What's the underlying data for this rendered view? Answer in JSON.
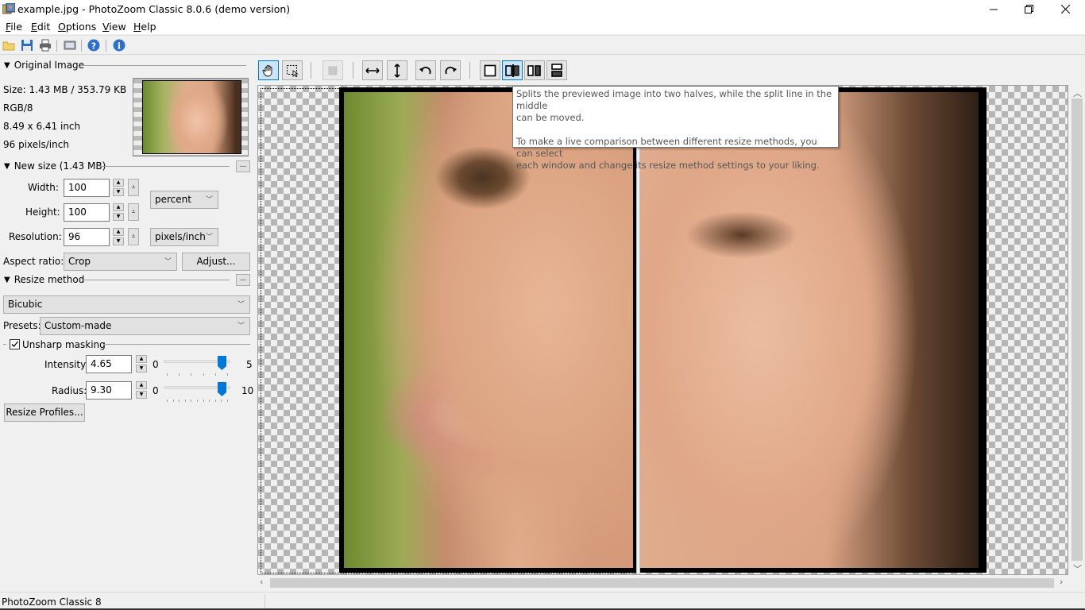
{
  "window": {
    "title": "example.jpg - PhotoZoom Classic 8.0.6 (demo version)",
    "controls": [
      "minimize",
      "restore",
      "close"
    ]
  },
  "menubar": {
    "items": [
      {
        "label": "File",
        "accel": "F"
      },
      {
        "label": "Edit",
        "accel": "E"
      },
      {
        "label": "Options",
        "accel": "O"
      },
      {
        "label": "View",
        "accel": "V"
      },
      {
        "label": "Help",
        "accel": "H"
      }
    ]
  },
  "toolbar": {
    "icons": [
      "open-folder-icon",
      "save-icon",
      "print-icon",
      "screen-icon",
      "help-icon",
      "info-icon"
    ]
  },
  "original_image": {
    "header": "Original Image",
    "size": "Size: 1.43 MB / 353.79 KB",
    "mode": "RGB/8",
    "dimensions": "8.49 x 6.41 inch",
    "resolution": "96 pixels/inch"
  },
  "new_size": {
    "header": "New size (1.43 MB)",
    "more_label": "...",
    "width_label": "Width:",
    "width_value": "100",
    "height_label": "Height:",
    "height_value": "100",
    "unit": "percent",
    "resolution_label": "Resolution:",
    "resolution_value": "96",
    "resolution_unit": "pixels/inch",
    "aspect_label": "Aspect ratio:",
    "aspect_value": "Crop",
    "adjust_label": "Adjust..."
  },
  "resize_method": {
    "header": "Resize method",
    "more_label": "...",
    "method": "Bicubic",
    "presets_label": "Presets:",
    "presets_value": "Custom-made",
    "unsharp_label": "Unsharp masking",
    "unsharp_checked": true,
    "intensity_label": "Intensity:",
    "intensity_value": "4.65",
    "intensity_min": "0",
    "intensity_max": "5",
    "intensity_fraction": 0.93,
    "radius_label": "Radius:",
    "radius_value": "9.30",
    "radius_min": "0",
    "radius_max": "10",
    "radius_fraction": 0.93,
    "profiles_label": "Resize Profiles..."
  },
  "view_toolbar": {
    "buttons": [
      {
        "name": "hand-tool",
        "active": true
      },
      {
        "name": "selection-tool",
        "active": false
      },
      {
        "name": "crop-tool",
        "active": false,
        "disabled": true
      },
      {
        "name": "fit-width",
        "active": false
      },
      {
        "name": "fit-height",
        "active": false
      },
      {
        "name": "rotate-left",
        "active": false
      },
      {
        "name": "rotate-right",
        "active": false
      },
      {
        "name": "single-view",
        "active": false
      },
      {
        "name": "split-view",
        "active": true
      },
      {
        "name": "side-by-side-view",
        "active": false
      },
      {
        "name": "top-bottom-view",
        "active": false
      }
    ]
  },
  "tooltip": {
    "line1": "Splits the previewed image into two halves, while the split line in the middle",
    "line2": "can be moved.",
    "line3": "To make a live comparison between different resize methods, you can select",
    "line4": "each window and change its resize method settings to your liking."
  },
  "statusbar": {
    "text": "PhotoZoom Classic 8"
  }
}
